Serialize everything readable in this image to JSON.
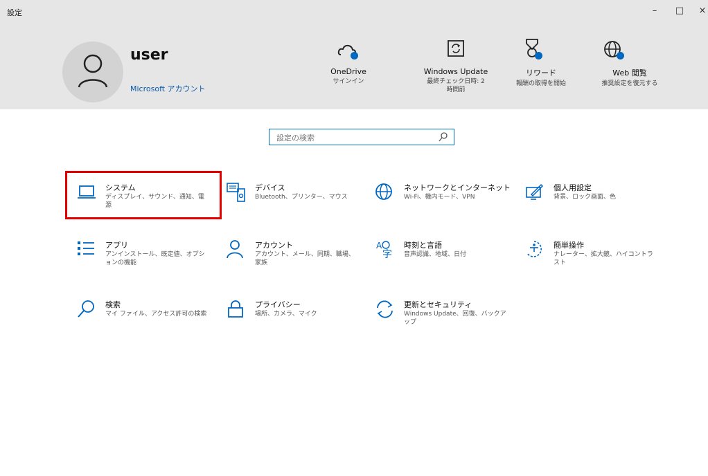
{
  "window": {
    "title": "設定",
    "minimize": "–",
    "maximize": "□",
    "close": "×"
  },
  "account": {
    "username": "user",
    "account_link": "Microsoft アカウント"
  },
  "header_items": [
    {
      "title": "OneDrive",
      "subtitle": "サインイン",
      "icon": "cloud-icon"
    },
    {
      "title": "Windows Update",
      "subtitle": "最終チェック日時: 2 時間前",
      "icon": "update-icon"
    },
    {
      "title": "リワード",
      "subtitle": "報酬の取得を開始",
      "icon": "trophy-icon"
    },
    {
      "title": "Web 閲覧",
      "subtitle": "推奨設定を復元する",
      "icon": "globe-icon"
    }
  ],
  "search": {
    "placeholder": "設定の検索"
  },
  "categories": [
    {
      "name": "システム",
      "desc": "ディスプレイ、サウンド、通知、電源",
      "icon": "laptop-icon"
    },
    {
      "name": "デバイス",
      "desc": "Bluetooth、プリンター、マウス",
      "icon": "devices-icon"
    },
    {
      "name": "ネットワークとインターネット",
      "desc": "Wi-Fi、機内モード、VPN",
      "icon": "globe-icon"
    },
    {
      "name": "個人用設定",
      "desc": "背景、ロック画面、色",
      "icon": "personalization-icon"
    },
    {
      "name": "アプリ",
      "desc": "アンインストール、既定値、オプションの機能",
      "icon": "apps-list-icon"
    },
    {
      "name": "アカウント",
      "desc": "アカウント、メール、同期、職場、家族",
      "icon": "person-icon"
    },
    {
      "name": "時刻と言語",
      "desc": "音声認識、地域、日付",
      "icon": "time-language-icon"
    },
    {
      "name": "簡単操作",
      "desc": "ナレーター、拡大鏡、ハイコントラスト",
      "icon": "accessibility-icon"
    },
    {
      "name": "検索",
      "desc": "マイ ファイル、アクセス許可の検索",
      "icon": "search-icon"
    },
    {
      "name": "プライバシー",
      "desc": "場所、カメラ、マイク",
      "icon": "lock-icon"
    },
    {
      "name": "更新とセキュリティ",
      "desc": "Windows Update、回復、バックアップ",
      "icon": "sync-icon"
    }
  ],
  "colors": {
    "accent": "#0067c0",
    "highlight": "#e50000",
    "header_bg": "#e6e6e6"
  }
}
